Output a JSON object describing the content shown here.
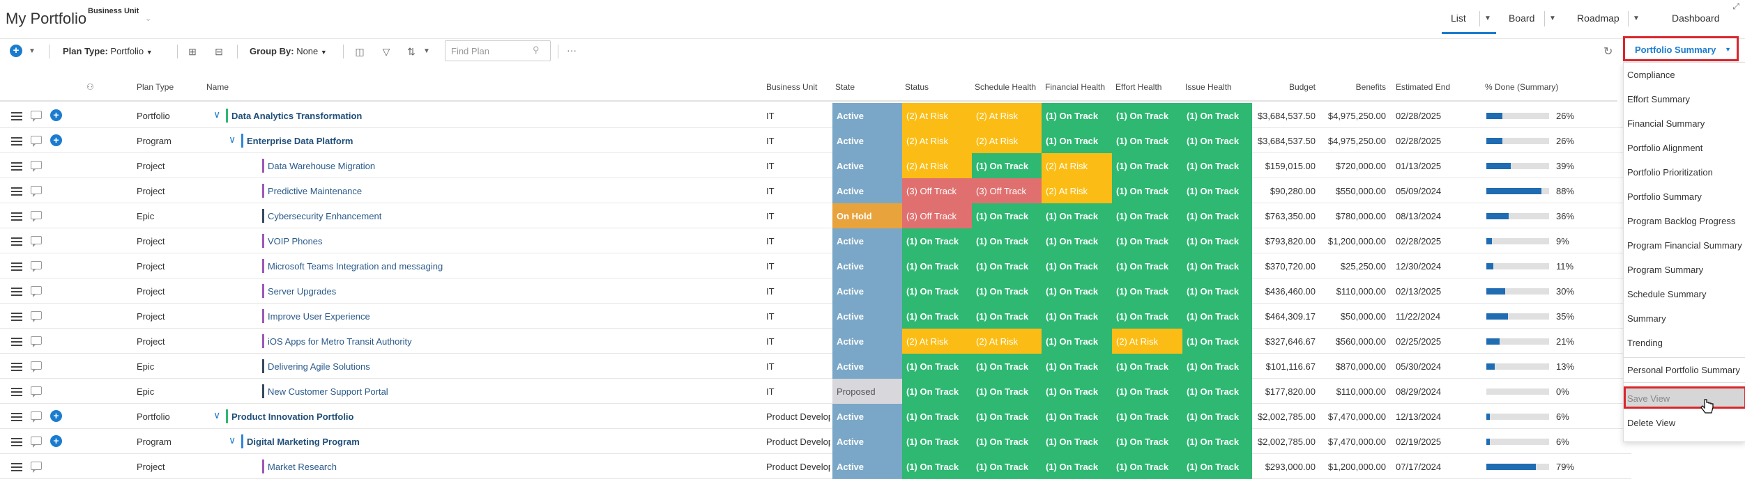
{
  "header": {
    "title": "My Portfolio",
    "filter_label": "Business Unit",
    "view_tabs": [
      "List",
      "Board",
      "Roadmap",
      "Dashboard"
    ]
  },
  "toolbar": {
    "plan_type_label": "Plan Type:",
    "plan_type_value": "Portfolio",
    "group_by_label": "Group By:",
    "group_by_value": "None",
    "search_placeholder": "Find Plan",
    "view_selected": "Portfolio Summary"
  },
  "columns": [
    "Plan Type",
    "Name",
    "Business Unit",
    "State",
    "Status",
    "Schedule Health",
    "Financial Health",
    "Effort Health",
    "Issue Health",
    "Budget",
    "Benefits",
    "Estimated End",
    "% Done (Summary)"
  ],
  "rows": [
    {
      "type": "Portfolio",
      "name": "Data Analytics Transformation",
      "level": 0,
      "bu": "IT",
      "state": "Active",
      "status": "(2) At Risk",
      "schedule": "(2) At Risk",
      "financial": "(1) On Track",
      "effort": "(1) On Track",
      "issue": "(1) On Track",
      "budget": "$3,684,537.50",
      "benefits": "$4,975,250.00",
      "end": "02/28/2025",
      "pct": "26%"
    },
    {
      "type": "Program",
      "name": "Enterprise Data Platform",
      "level": 1,
      "bu": "IT",
      "state": "Active",
      "status": "(2) At Risk",
      "schedule": "(2) At Risk",
      "financial": "(1) On Track",
      "effort": "(1) On Track",
      "issue": "(1) On Track",
      "budget": "$3,684,537.50",
      "benefits": "$4,975,250.00",
      "end": "02/28/2025",
      "pct": "26%"
    },
    {
      "type": "Project",
      "name": "Data Warehouse Migration",
      "level": 2,
      "bu": "IT",
      "state": "Active",
      "status": "(2) At Risk",
      "schedule": "(1) On Track",
      "financial": "(2) At Risk",
      "effort": "(1) On Track",
      "issue": "(1) On Track",
      "budget": "$159,015.00",
      "benefits": "$720,000.00",
      "end": "01/13/2025",
      "pct": "39%"
    },
    {
      "type": "Project",
      "name": "Predictive Maintenance",
      "level": 2,
      "bu": "IT",
      "state": "Active",
      "status": "(3) Off Track",
      "schedule": "(3) Off Track",
      "financial": "(2) At Risk",
      "effort": "(1) On Track",
      "issue": "(1) On Track",
      "budget": "$90,280.00",
      "benefits": "$550,000.00",
      "end": "05/09/2024",
      "pct": "88%"
    },
    {
      "type": "Epic",
      "name": "Cybersecurity Enhancement",
      "level": 2,
      "bu": "IT",
      "state": "On Hold",
      "status": "(3) Off Track",
      "schedule": "(1) On Track",
      "financial": "(1) On Track",
      "effort": "(1) On Track",
      "issue": "(1) On Track",
      "budget": "$763,350.00",
      "benefits": "$780,000.00",
      "end": "08/13/2024",
      "pct": "36%"
    },
    {
      "type": "Project",
      "name": "VOIP Phones",
      "level": 2,
      "bu": "IT",
      "state": "Active",
      "status": "(1) On Track",
      "schedule": "(1) On Track",
      "financial": "(1) On Track",
      "effort": "(1) On Track",
      "issue": "(1) On Track",
      "budget": "$793,820.00",
      "benefits": "$1,200,000.00",
      "end": "02/28/2025",
      "pct": "9%"
    },
    {
      "type": "Project",
      "name": "Microsoft Teams Integration and messaging",
      "level": 2,
      "bu": "IT",
      "state": "Active",
      "status": "(1) On Track",
      "schedule": "(1) On Track",
      "financial": "(1) On Track",
      "effort": "(1) On Track",
      "issue": "(1) On Track",
      "budget": "$370,720.00",
      "benefits": "$25,250.00",
      "end": "12/30/2024",
      "pct": "11%"
    },
    {
      "type": "Project",
      "name": "Server Upgrades",
      "level": 2,
      "bu": "IT",
      "state": "Active",
      "status": "(1) On Track",
      "schedule": "(1) On Track",
      "financial": "(1) On Track",
      "effort": "(1) On Track",
      "issue": "(1) On Track",
      "budget": "$436,460.00",
      "benefits": "$110,000.00",
      "end": "02/13/2025",
      "pct": "30%"
    },
    {
      "type": "Project",
      "name": "Improve User Experience",
      "level": 2,
      "bu": "IT",
      "state": "Active",
      "status": "(1) On Track",
      "schedule": "(1) On Track",
      "financial": "(1) On Track",
      "effort": "(1) On Track",
      "issue": "(1) On Track",
      "budget": "$464,309.17",
      "benefits": "$50,000.00",
      "end": "11/22/2024",
      "pct": "35%"
    },
    {
      "type": "Project",
      "name": "iOS Apps for Metro Transit Authority",
      "level": 2,
      "bu": "IT",
      "state": "Active",
      "status": "(2) At Risk",
      "schedule": "(2) At Risk",
      "financial": "(1) On Track",
      "effort": "(2) At Risk",
      "issue": "(1) On Track",
      "budget": "$327,646.67",
      "benefits": "$560,000.00",
      "end": "02/25/2025",
      "pct": "21%"
    },
    {
      "type": "Epic",
      "name": "Delivering Agile Solutions",
      "level": 2,
      "bu": "IT",
      "state": "Active",
      "status": "(1) On Track",
      "schedule": "(1) On Track",
      "financial": "(1) On Track",
      "effort": "(1) On Track",
      "issue": "(1) On Track",
      "budget": "$101,116.67",
      "benefits": "$870,000.00",
      "end": "05/30/2024",
      "pct": "13%"
    },
    {
      "type": "Epic",
      "name": "New Customer Support Portal",
      "level": 2,
      "bu": "IT",
      "state": "Proposed",
      "status": "(1) On Track",
      "schedule": "(1) On Track",
      "financial": "(1) On Track",
      "effort": "(1) On Track",
      "issue": "(1) On Track",
      "budget": "$177,820.00",
      "benefits": "$110,000.00",
      "end": "08/29/2024",
      "pct": "0%"
    },
    {
      "type": "Portfolio",
      "name": "Product Innovation Portfolio",
      "level": 0,
      "bu": "Product Develop",
      "state": "Active",
      "status": "(1) On Track",
      "schedule": "(1) On Track",
      "financial": "(1) On Track",
      "effort": "(1) On Track",
      "issue": "(1) On Track",
      "budget": "$2,002,785.00",
      "benefits": "$7,470,000.00",
      "end": "12/13/2024",
      "pct": "6%"
    },
    {
      "type": "Program",
      "name": "Digital Marketing Program",
      "level": 1,
      "bu": "Product Develop",
      "state": "Active",
      "status": "(1) On Track",
      "schedule": "(1) On Track",
      "financial": "(1) On Track",
      "effort": "(1) On Track",
      "issue": "(1) On Track",
      "budget": "$2,002,785.00",
      "benefits": "$7,470,000.00",
      "end": "02/19/2025",
      "pct": "6%"
    },
    {
      "type": "Project",
      "name": "Market Research",
      "level": 2,
      "bu": "Product Develop",
      "state": "Active",
      "status": "(1) On Track",
      "schedule": "(1) On Track",
      "financial": "(1) On Track",
      "effort": "(1) On Track",
      "issue": "(1) On Track",
      "budget": "$293,000.00",
      "benefits": "$1,200,000.00",
      "end": "07/17/2024",
      "pct": "79%"
    }
  ],
  "view_menu": {
    "items": [
      "Compliance",
      "Effort Summary",
      "Financial Summary",
      "Portfolio Alignment",
      "Portfolio Prioritization",
      "Portfolio Summary",
      "Program Backlog Progress",
      "Program Financial Summary",
      "Program Summary",
      "Schedule Summary",
      "Summary",
      "Trending"
    ],
    "personal": [
      "Personal Portfolio Summary"
    ],
    "actions": [
      "Save View",
      "Delete View"
    ]
  },
  "colors": {
    "active": "#7aa7c7",
    "on_hold": "#e8a33d",
    "proposed": "#d7d7dc",
    "on_track": "#2eb872",
    "at_risk": "#fbbd15",
    "off_track": "#e07070",
    "accent": "#1b7ccf",
    "highlight_border": "#d9262c"
  }
}
